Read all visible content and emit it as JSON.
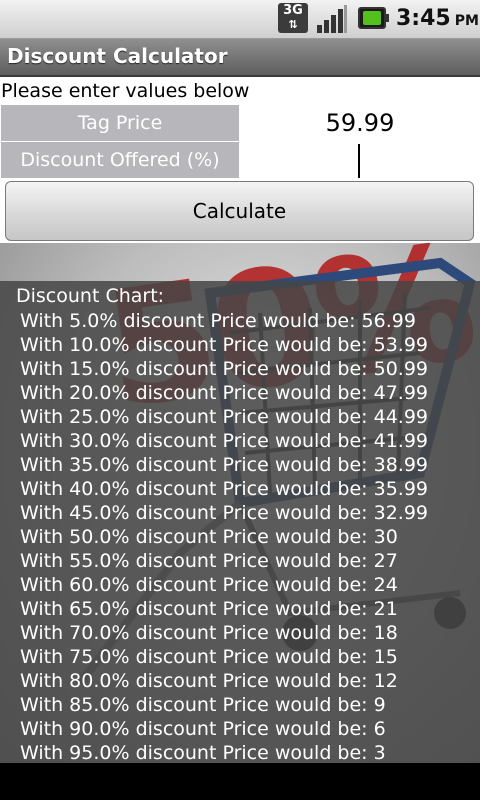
{
  "status_bar": {
    "network": "3G",
    "network_arrows": "⇅",
    "time": "3:45",
    "ampm": "PM",
    "icons": [
      "3g-network-icon",
      "signal-strength-icon",
      "battery-charging-icon"
    ]
  },
  "app": {
    "title": "Discount Calculator"
  },
  "form": {
    "prompt": "Please enter values below",
    "tag_price_label": "Tag Price",
    "tag_price_value": "59.99",
    "discount_label": "Discount Offered (%)",
    "discount_value": "",
    "calculate_label": "Calculate"
  },
  "results": {
    "heading": "Discount Chart:",
    "rows": [
      "With 5.0% discount Price would be: 56.99",
      "With 10.0% discount Price would be: 53.99",
      "With 15.0% discount Price would be: 50.99",
      "With 20.0% discount Price would be: 47.99",
      "With 25.0% discount Price would be: 44.99",
      "With 30.0% discount Price would be: 41.99",
      "With 35.0% discount Price would be: 38.99",
      "With 40.0% discount Price would be: 35.99",
      "With 45.0% discount Price would be: 32.99",
      "With 50.0% discount Price would be: 30",
      "With 55.0% discount Price would be: 27",
      "With 60.0% discount Price would be: 24",
      "With 65.0% discount Price would be: 21",
      "With 70.0% discount Price would be: 18",
      "With 75.0% discount Price would be: 15",
      "With 80.0% discount Price would be: 12",
      "With 85.0% discount Price would be: 9",
      "With 90.0% discount Price would be: 6",
      "With 95.0% discount Price would be: 3"
    ]
  },
  "colors": {
    "label_cell_bg": "#b7b7bb",
    "results_panel_bg": "#464646",
    "background_image_red": "#b01818",
    "battery_green": "#55c01d"
  },
  "background_image": "shopping-cart-sale-image"
}
